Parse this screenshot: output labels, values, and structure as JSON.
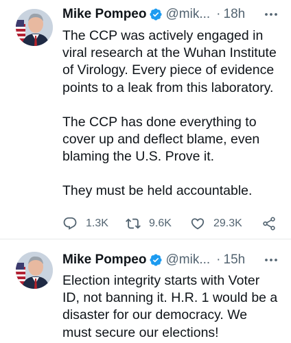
{
  "tweets": [
    {
      "author_name": "Mike Pompeo",
      "handle": "@mik...",
      "separator": "·",
      "time": "18h",
      "verified": true,
      "lines": [
        "The CCP was actively engaged in",
        "viral research at the Wuhan Institute",
        "of Virology. Every piece of evidence",
        "points to a leak from this laboratory.",
        "",
        "The CCP has done everything to",
        "cover up and deflect blame, even",
        "blaming the U.S. Prove it.",
        "",
        "They must be held accountable."
      ],
      "actions": {
        "reply_count": "1.3K",
        "retweet_count": "9.6K",
        "like_count": "29.3K"
      }
    },
    {
      "author_name": "Mike Pompeo",
      "handle": "@mik...",
      "separator": "·",
      "time": "15h",
      "verified": true,
      "lines": [
        "Election integrity starts with Voter",
        "ID, not banning it. H.R. 1 would be a",
        "disaster for our democracy. We",
        "must secure our elections!"
      ]
    }
  ],
  "icons": {
    "verified": "verified-badge-icon",
    "more": "more-options-icon",
    "reply": "reply-icon",
    "retweet": "retweet-icon",
    "like": "like-heart-icon",
    "share": "share-icon"
  },
  "colors": {
    "text": "#0f1419",
    "secondary": "#536471",
    "verified_blue": "#1d9bf0",
    "divider": "#e7e9ea"
  }
}
